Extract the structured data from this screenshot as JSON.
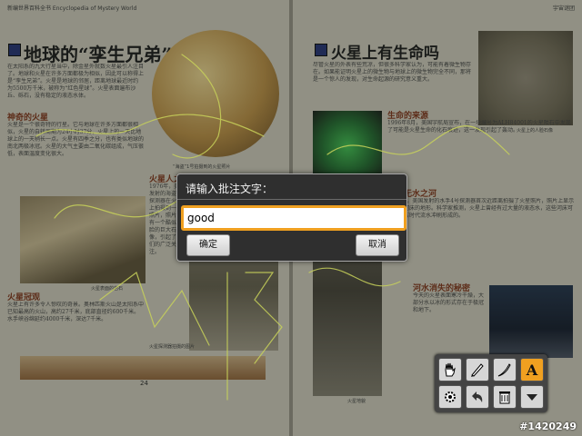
{
  "left_page": {
    "header": "新编世界百科全书 Encyclopedia of Mystery World",
    "title": "地球的“孪生兄弟”",
    "intro": "在太阳系的九大行星当中，除金星外就数火星最引人注目了。地球和火星在许多方面都极为相似，因此可以称得上是“孪生兄弟”。火星是地球的邻居，距离地球最近时约为5500万千米，被称为“红色星球”。火星表面遍布沙丘、砾石，没有稳定的液态水体。",
    "section1_title": "神奇的火星",
    "section1_text": "火星是一个很奇特的行星。它与地球在许多方面都很相似，火星的自转周期为24小时37分，火星上的一天比地球上的一天稍长一点。火星有四季之分，也有类似地球的南北两极冰冠。火星的大气主要由二氧化碳组成，气压很低，表面温度变化很大。",
    "caption1": "火星表面的岩石",
    "section2_title": "火星人之谜",
    "section2_text": "1976年，美国发射的海盗号探测器在火星上拍摄到一张照片，照片上有一个酷似人脸的巨大石像，引起了人们的广泛关注。",
    "section3_title": "火星冠观",
    "section3_text": "火星上有许多令人惊叹的奇景。奥林匹斯火山是太阳系中已知最高的火山，高约27千米，底部直径约600千米。水手峡谷绵延约4000千米，深达7千米。",
    "caption2": "火星探测器拍摄的图片",
    "caption3": "“海盗”1号拍摄到的火星照片",
    "page_number": "24"
  },
  "right_page": {
    "header": "宇宙谜团",
    "title": "火星上有生命吗",
    "intro": "尽管火星的外表有些荒凉，但很多科学家认为，可能有着微生物存在。如果能证明火星上的微生物与地球上的微生物完全不同，那将是一个惊人的发现，对生命起源的研究意义重大。",
    "section1_title": "生命的来源",
    "section1_text": "1996年8月，美国宇航局宣布，在一块编号为ALH84001的火星陨石中发现了可能是火星生命的化石痕迹，这一发现引起了轰动。",
    "section2_title": "火星无水之河",
    "section2_text": "1964年，美国发射的水手4号探测器首次近距离拍摄了火星照片，照片上显示出类似河床的地形。科学家推测，火星上曾经有过大量的液态水，这些河床可能是远古时代流水冲刷形成的。",
    "section3_title": "河水消失的秘密",
    "section3_text": "今天的火星表面寒冷干燥，大部分水以冰的形式存在于极冠和地下。",
    "caption1": "火星上的人脸石像",
    "caption2": "火星地貌"
  },
  "dialog": {
    "title": "请输入批注文字：",
    "input_value": "good",
    "confirm_label": "确定",
    "cancel_label": "取消"
  },
  "toolbar": {
    "row1": [
      "hand-icon",
      "pen-icon",
      "brush-icon",
      "text-icon"
    ],
    "row2": [
      "settings-icon",
      "undo-icon",
      "trash-icon",
      "collapse-icon"
    ],
    "active_color": "#f0a020"
  },
  "watermark": "#1420249"
}
